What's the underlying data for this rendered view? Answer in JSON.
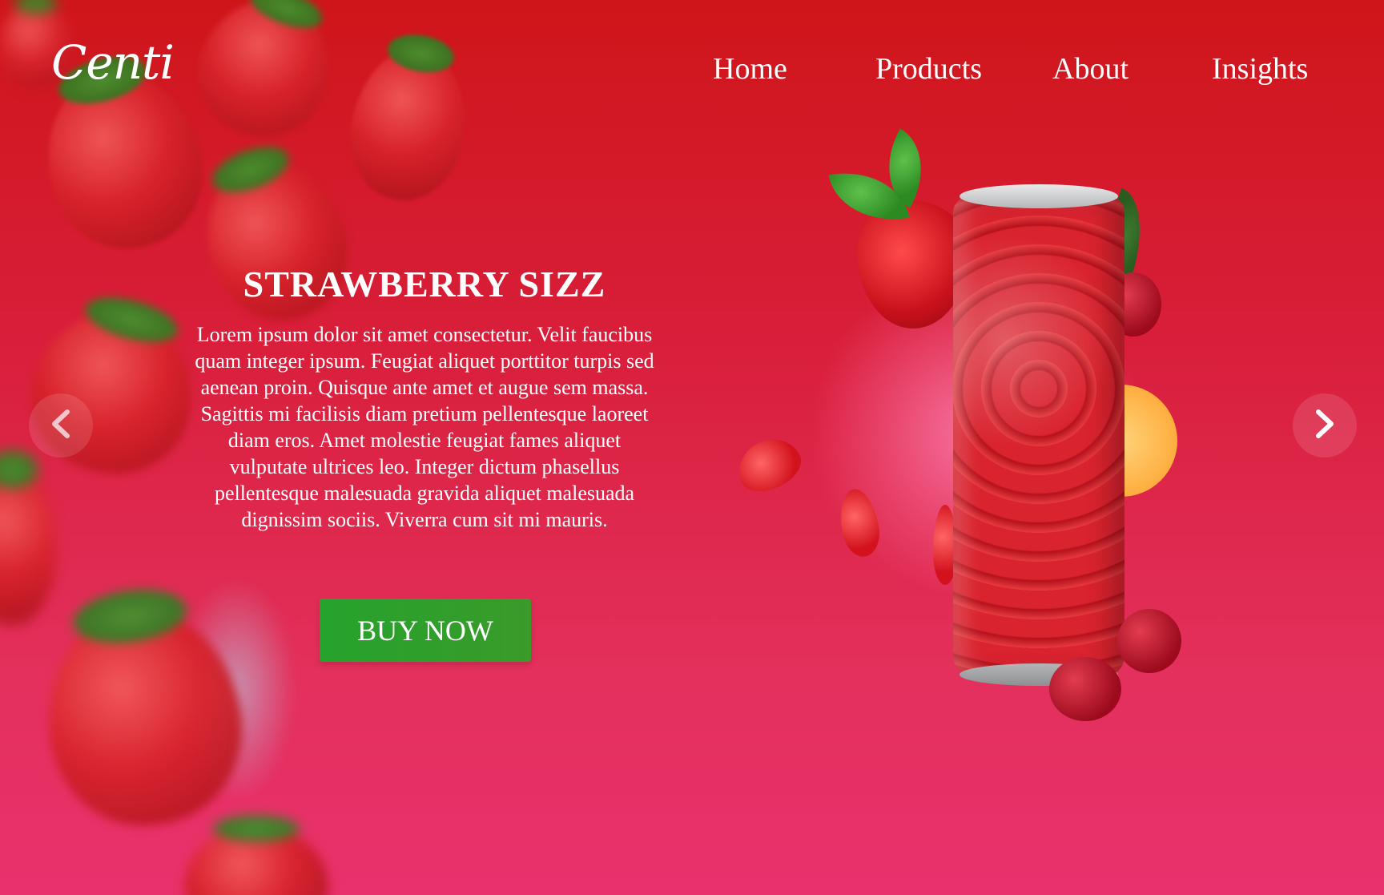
{
  "brand": {
    "logo_text": "Centi"
  },
  "nav": {
    "items": [
      {
        "label": "Home"
      },
      {
        "label": "Products"
      },
      {
        "label": "About"
      },
      {
        "label": "Insights"
      }
    ]
  },
  "hero": {
    "title": "STRAWBERRY SIZZ",
    "description": "Lorem ipsum dolor sit amet consectetur. Velit faucibus quam integer ipsum. Feugiat aliquet porttitor turpis sed aenean proin. Quisque ante amet et augue sem massa. Sagittis mi facilisis diam pretium pellentesque laoreet diam eros. Amet molestie feugiat fames aliquet vulputate ultrices leo. Integer dictum phasellus pellentesque malesuada gravida aliquet malesuada dignissim sociis. Viverra cum sit mi mauris.",
    "cta_label": "BUY NOW"
  },
  "carousel": {
    "prev_icon": "chevron-left-icon",
    "next_icon": "chevron-right-icon"
  },
  "colors": {
    "background_top": "#cf1519",
    "background_bottom": "#e9316d",
    "cta": "#26a32c",
    "text": "#ffffff"
  }
}
